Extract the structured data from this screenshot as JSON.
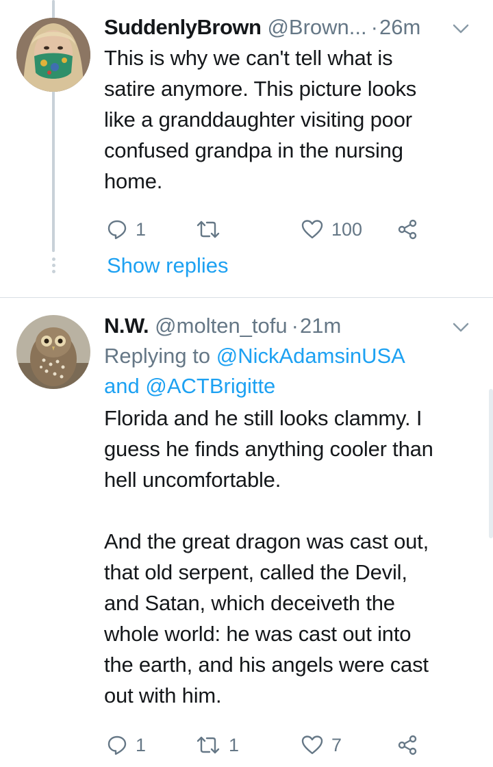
{
  "tweets": [
    {
      "display_name": "SuddenlyBrown",
      "handle": "@Brown...",
      "separator": "·",
      "time": "26m",
      "body": "This is why we can't tell what is\nsatire anymore. This picture looks\nlike a granddaughter visiting poor\nconfused grandpa in the nursing\nhome.",
      "reply_count": "1",
      "retweet_count": "",
      "like_count": "100",
      "avatar_icon": "masked-person-avatar"
    },
    {
      "display_name": "N.W.",
      "handle": "@molten_tofu",
      "separator": "·",
      "time": "21m",
      "replying_prefix": "Replying to ",
      "replying_mention_1": "@NickAdamsinUSA",
      "replying_and": "and ",
      "replying_mention_2": "@ACTBrigitte",
      "body": "Florida and he still looks clammy. I\nguess he finds anything cooler than\nhell uncomfortable.\n\nAnd the great dragon was cast out,\nthat old serpent, called the Devil,\nand Satan, which deceiveth the\nwhole world: he was cast out into\nthe earth, and his angels were cast\nout with him.",
      "reply_count": "1",
      "retweet_count": "1",
      "like_count": "7",
      "avatar_icon": "owl-avatar"
    }
  ],
  "show_replies_label": "Show replies",
  "colors": {
    "accent": "#1da1f2",
    "muted": "#657786",
    "text": "#14171a",
    "thread_line": "#c8d1d8"
  }
}
